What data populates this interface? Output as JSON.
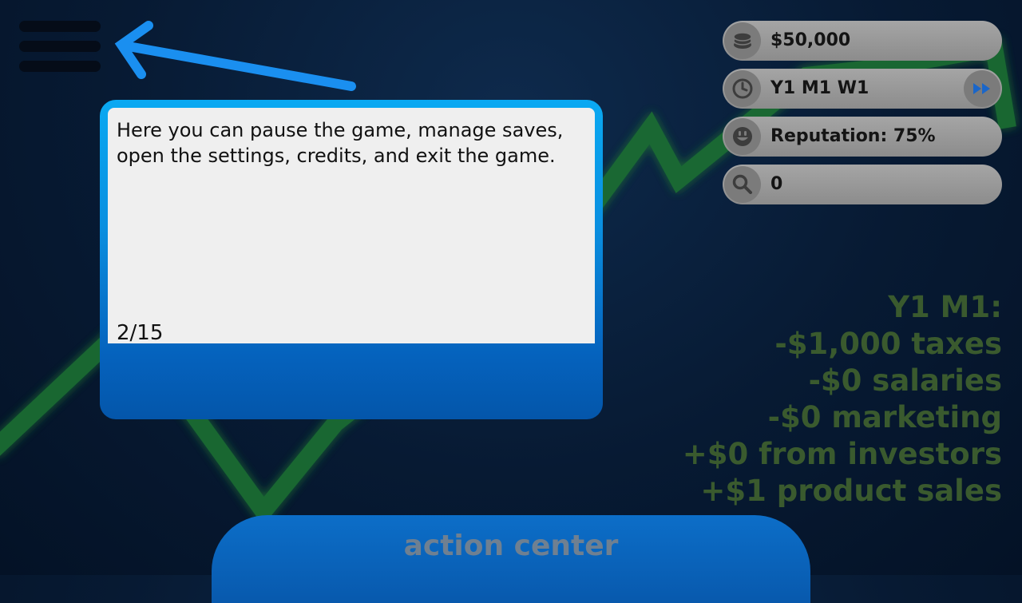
{
  "menu": {
    "icon": "hamburger-menu-icon"
  },
  "tutorial": {
    "text": "Here you can pause the game, manage saves, open the settings, credits, and exit the game.",
    "page": "2/15",
    "arrow_color": "#1a8ff0"
  },
  "stats": {
    "money": "$50,000",
    "date": "Y1 M1 W1",
    "reputation": "Reputation: 75%",
    "search_count": "0",
    "icons": [
      "coins-icon",
      "clock-icon",
      "smiley-face-icon",
      "magnifier-icon",
      "fast-forward-icon"
    ]
  },
  "report": {
    "title": "Y1 M1:",
    "lines": [
      "-$1,000 taxes",
      "-$0 salaries",
      "-$0 marketing",
      "+$0 from investors",
      "+$1 product sales"
    ]
  },
  "action_center": {
    "label": "action center"
  },
  "colors": {
    "background": "#071a33",
    "chart_line": "#2aa84a",
    "dialog": "#0a8fe0",
    "pill": "#9a9a9a",
    "report_text": "#3a5a2e"
  }
}
